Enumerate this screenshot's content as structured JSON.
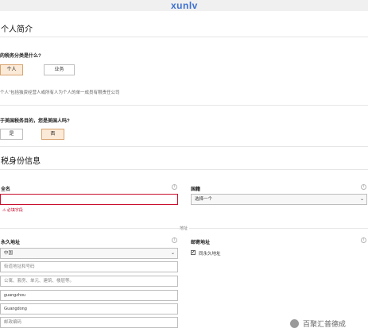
{
  "watermark_top": "xunlv",
  "watermark_bottom": "百聚汇普德成",
  "profile": {
    "title": "个人简介",
    "classification_question": "的税务分类是什么?",
    "options": [
      "个人",
      "业务"
    ],
    "selected_option": "个人",
    "note": "个人\"包括独资经营人或所有人为个人的单一成员有限责任公司",
    "us_person_question": "于美国税务目的，您是美国人吗?",
    "us_person_options": [
      "是",
      "否"
    ],
    "us_person_selected": "否"
  },
  "tax_identity": {
    "title": "税身份信息",
    "name_label": "全名",
    "name_value": "",
    "name_error": "必填字段",
    "country_label": "国籍",
    "country_value": "选择一个",
    "separator_label": "地址",
    "permanent_address_label": "永久地址",
    "permanent_country": "中国",
    "street_placeholder": "街道地址和号码",
    "apartment_placeholder": "公寓、套房、单元、建筑、楼层等。",
    "city_value": "guangzhou",
    "province_value": "Guangdong",
    "postal_placeholder": "邮政编码",
    "mailing_address_label": "邮寄地址",
    "same_as_permanent": "同永久地址",
    "same_checked": "✔"
  }
}
